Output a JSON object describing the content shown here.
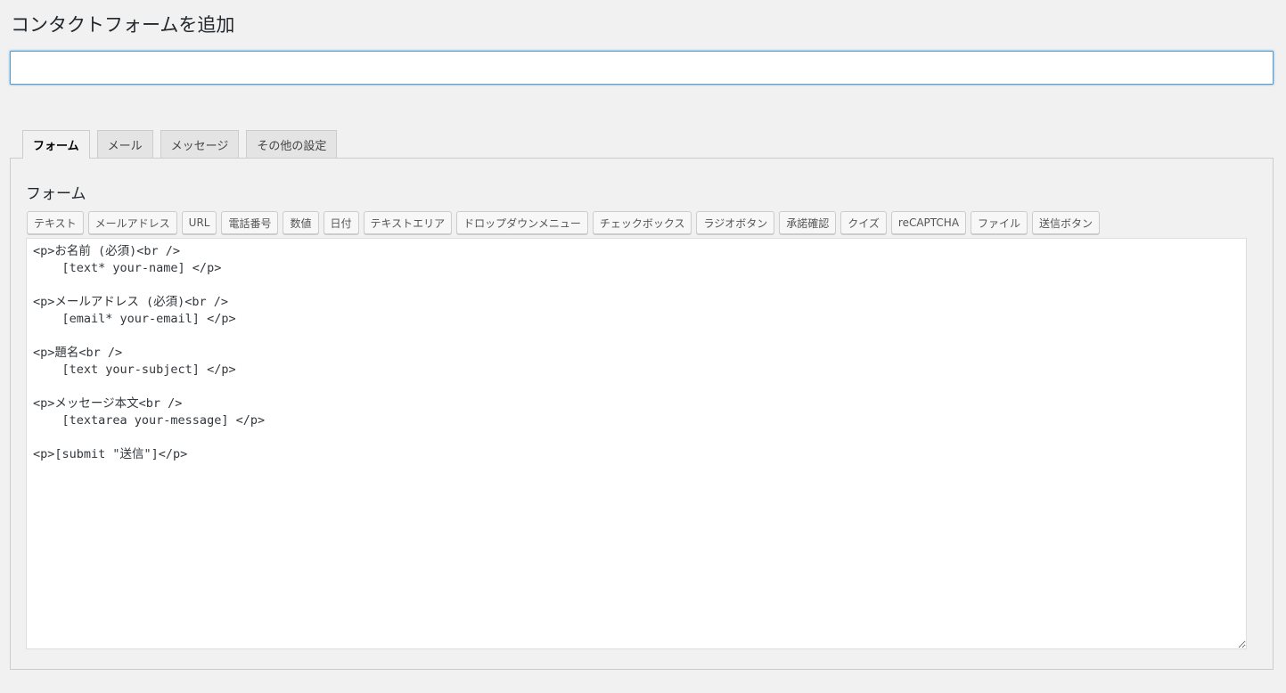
{
  "header": {
    "title": "コンタクトフォームを追加",
    "title_input_value": ""
  },
  "tabs": [
    {
      "label": "フォーム",
      "active": true
    },
    {
      "label": "メール",
      "active": false
    },
    {
      "label": "メッセージ",
      "active": false
    },
    {
      "label": "その他の設定",
      "active": false
    }
  ],
  "panel": {
    "heading": "フォーム",
    "tag_buttons": [
      "テキスト",
      "メールアドレス",
      "URL",
      "電話番号",
      "数値",
      "日付",
      "テキストエリア",
      "ドロップダウンメニュー",
      "チェックボックス",
      "ラジオボタン",
      "承諾確認",
      "クイズ",
      "reCAPTCHA",
      "ファイル",
      "送信ボタン"
    ],
    "editor_content": "<p>お名前 (必須)<br />\n    [text* your-name] </p>\n\n<p>メールアドレス (必須)<br />\n    [email* your-email] </p>\n\n<p>題名<br />\n    [text your-subject] </p>\n\n<p>メッセージ本文<br />\n    [textarea your-message] </p>\n\n<p>[submit \"送信\"]</p>"
  },
  "colors": {
    "background": "#f1f1f1",
    "input_focus_border": "#5b9dd9"
  }
}
